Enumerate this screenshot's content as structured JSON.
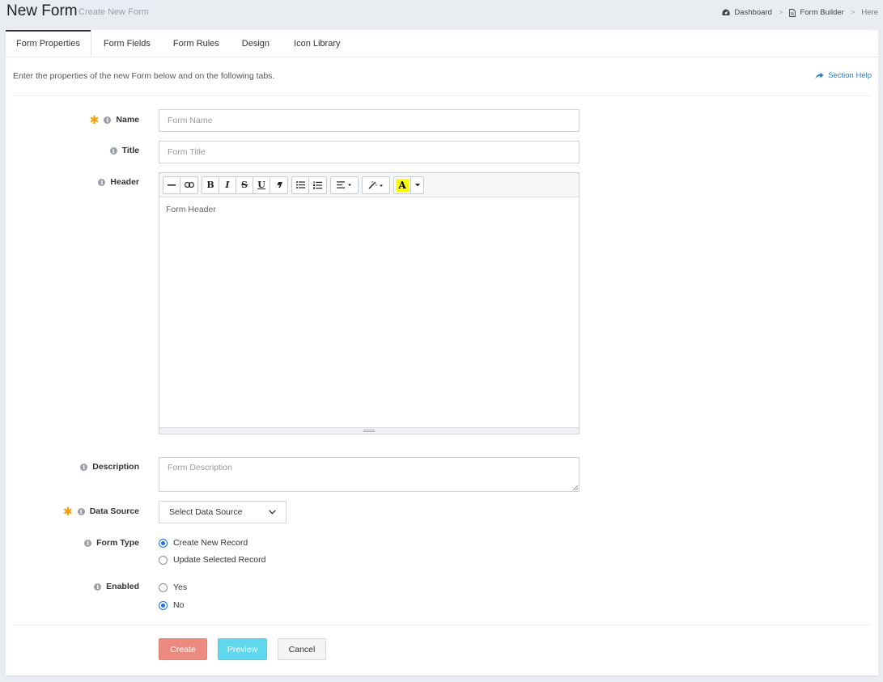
{
  "header": {
    "title": "New Form",
    "subtitle": "Create New Form",
    "breadcrumb": [
      "Dashboard",
      "Form Builder",
      "Here"
    ]
  },
  "tabs": [
    {
      "label": "Form Properties",
      "active": true
    },
    {
      "label": "Form Fields",
      "active": false
    },
    {
      "label": "Form Rules",
      "active": false
    },
    {
      "label": "Design",
      "active": false
    },
    {
      "label": "Icon Library",
      "active": false
    }
  ],
  "intro_text": "Enter the properties of the new Form below and on the following tabs.",
  "section_help": "Section Help",
  "fields": {
    "name": {
      "label": "Name",
      "placeholder": "Form Name",
      "required": true
    },
    "title": {
      "label": "Title",
      "placeholder": "Form Title"
    },
    "header": {
      "label": "Header",
      "placeholder": "Form Header"
    },
    "description": {
      "label": "Description",
      "placeholder": "Form Description"
    },
    "data_source": {
      "label": "Data Source",
      "selected": "Select Data Source",
      "required": true
    },
    "form_type": {
      "label": "Form Type",
      "options": [
        "Create New Record",
        "Update Selected Record"
      ],
      "selected": "Create New Record"
    },
    "enabled": {
      "label": "Enabled",
      "options": [
        "Yes",
        "No"
      ],
      "selected": "No"
    }
  },
  "editor_toolbar": [
    "hr-icon",
    "link-icon",
    "bold-icon",
    "italic-icon",
    "strikethrough-icon",
    "underline-icon",
    "eraser-icon",
    "unordered-list-icon",
    "ordered-list-icon",
    "align-icon",
    "magic-wand-icon",
    "text-color-icon"
  ],
  "toolbar_glyphs": {
    "bold": "B",
    "italic": "I",
    "strike": "S",
    "underline": "U",
    "color": "A"
  },
  "buttons": {
    "create": "Create",
    "preview": "Preview",
    "cancel": "Cancel"
  },
  "colors": {
    "required": "#f0a10c",
    "link": "#2c7ec5",
    "create": "#ec8a80",
    "preview": "#61d7ee",
    "radio_checked": "#1a73e8",
    "highlight": "#ffff00"
  }
}
